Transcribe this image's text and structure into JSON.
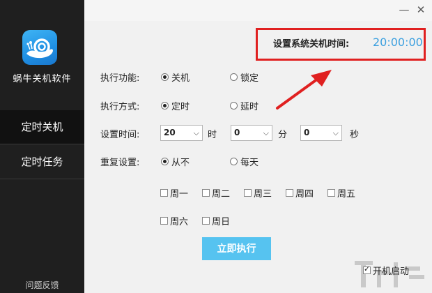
{
  "app": {
    "name": "蜗牛关机软件"
  },
  "sidebar": {
    "items": [
      {
        "label": "定时关机",
        "active": true
      },
      {
        "label": "定时任务",
        "active": false
      }
    ],
    "feedback": "问题反馈"
  },
  "window": {
    "minimize": "—",
    "close": "✕"
  },
  "shutdown_time": {
    "label": "设置系统关机时间:",
    "value": "20:00:00"
  },
  "form": {
    "function": {
      "label": "执行功能:",
      "options": [
        "关机",
        "锁定"
      ],
      "selected": "关机"
    },
    "mode": {
      "label": "执行方式:",
      "options": [
        "定时",
        "延时"
      ],
      "selected": "定时"
    },
    "time": {
      "label": "设置时间:",
      "hour": "20",
      "hour_unit": "时",
      "minute": "0",
      "minute_unit": "分",
      "second": "0",
      "second_unit": "秒"
    },
    "repeat": {
      "label": "重复设置:",
      "options": [
        "从不",
        "每天"
      ],
      "selected": "从不"
    },
    "weekdays": [
      "周一",
      "周二",
      "周三",
      "周四",
      "周五",
      "周六",
      "周日"
    ],
    "execute_button": "立即执行",
    "autostart": {
      "label": "开机启动",
      "checked": true
    }
  },
  "colors": {
    "sidebar_bg": "#1f1f1f",
    "accent": "#56c3f0",
    "time_value": "#3a9fdf",
    "highlight": "#e02020"
  }
}
